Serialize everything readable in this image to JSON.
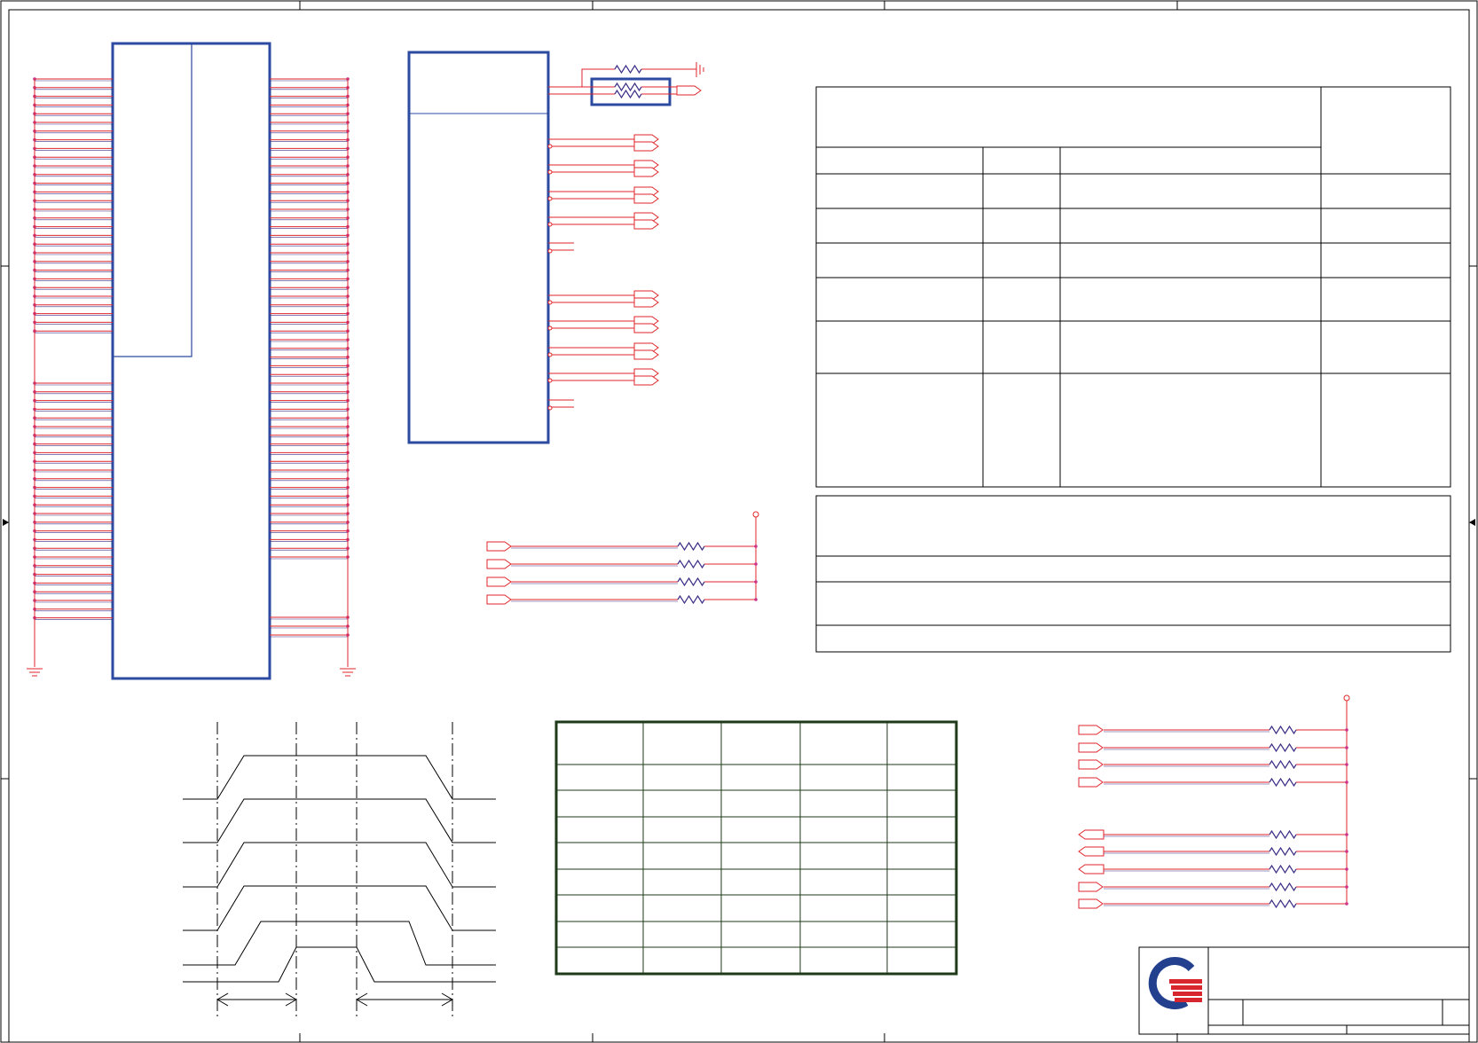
{
  "sheet": {
    "colors": {
      "frame": "#000000",
      "component_blue": "#2b4aa0",
      "wire_red": "#e0262b",
      "wire_purple": "#3a2d86",
      "junction_pink": "#cc3388",
      "grid_green": "#1e3a18",
      "logo_blue": "#23408e",
      "logo_red": "#d7262e"
    },
    "icons": [
      "ground-symbol",
      "power-rail",
      "resistor-symbol",
      "offpage-connector",
      "company-logo"
    ]
  },
  "timing_diagram": {
    "signal_count": 6,
    "marker_count": 4
  },
  "spec_table": {
    "columns": 4,
    "rows": 6
  },
  "notes_table": {
    "rows": 4
  },
  "config_grid": {
    "columns": 5,
    "rows": 9
  },
  "title_block": {
    "logo": "company-logo"
  }
}
